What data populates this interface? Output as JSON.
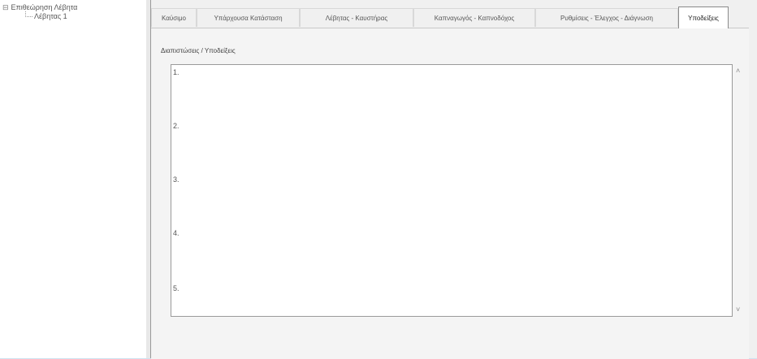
{
  "tree": {
    "root_label": "Επιθεώρηση Λέβητα",
    "root_glyph": "⊟",
    "child_label": "Λέβητας 1"
  },
  "tabs": [
    {
      "label": "Καύσιμο",
      "active": false
    },
    {
      "label": "Υπάρχουσα Κατάσταση",
      "active": false
    },
    {
      "label": "Λέβητας - Καυστήρας",
      "active": false
    },
    {
      "label": "Καπναγωγός - Καπνοδόχος",
      "active": false
    },
    {
      "label": "Ρυθμίσεις - Έλεγχος - Διάγνωση",
      "active": false
    },
    {
      "label": "Υποδείξεις",
      "active": true
    }
  ],
  "section": {
    "label": "Διαπιστώσεις / Υποδείξεις"
  },
  "notes": {
    "lines": [
      "1.",
      "2.",
      "3.",
      "4.",
      "5."
    ]
  },
  "scroll": {
    "up": "˄",
    "down": "˅"
  }
}
